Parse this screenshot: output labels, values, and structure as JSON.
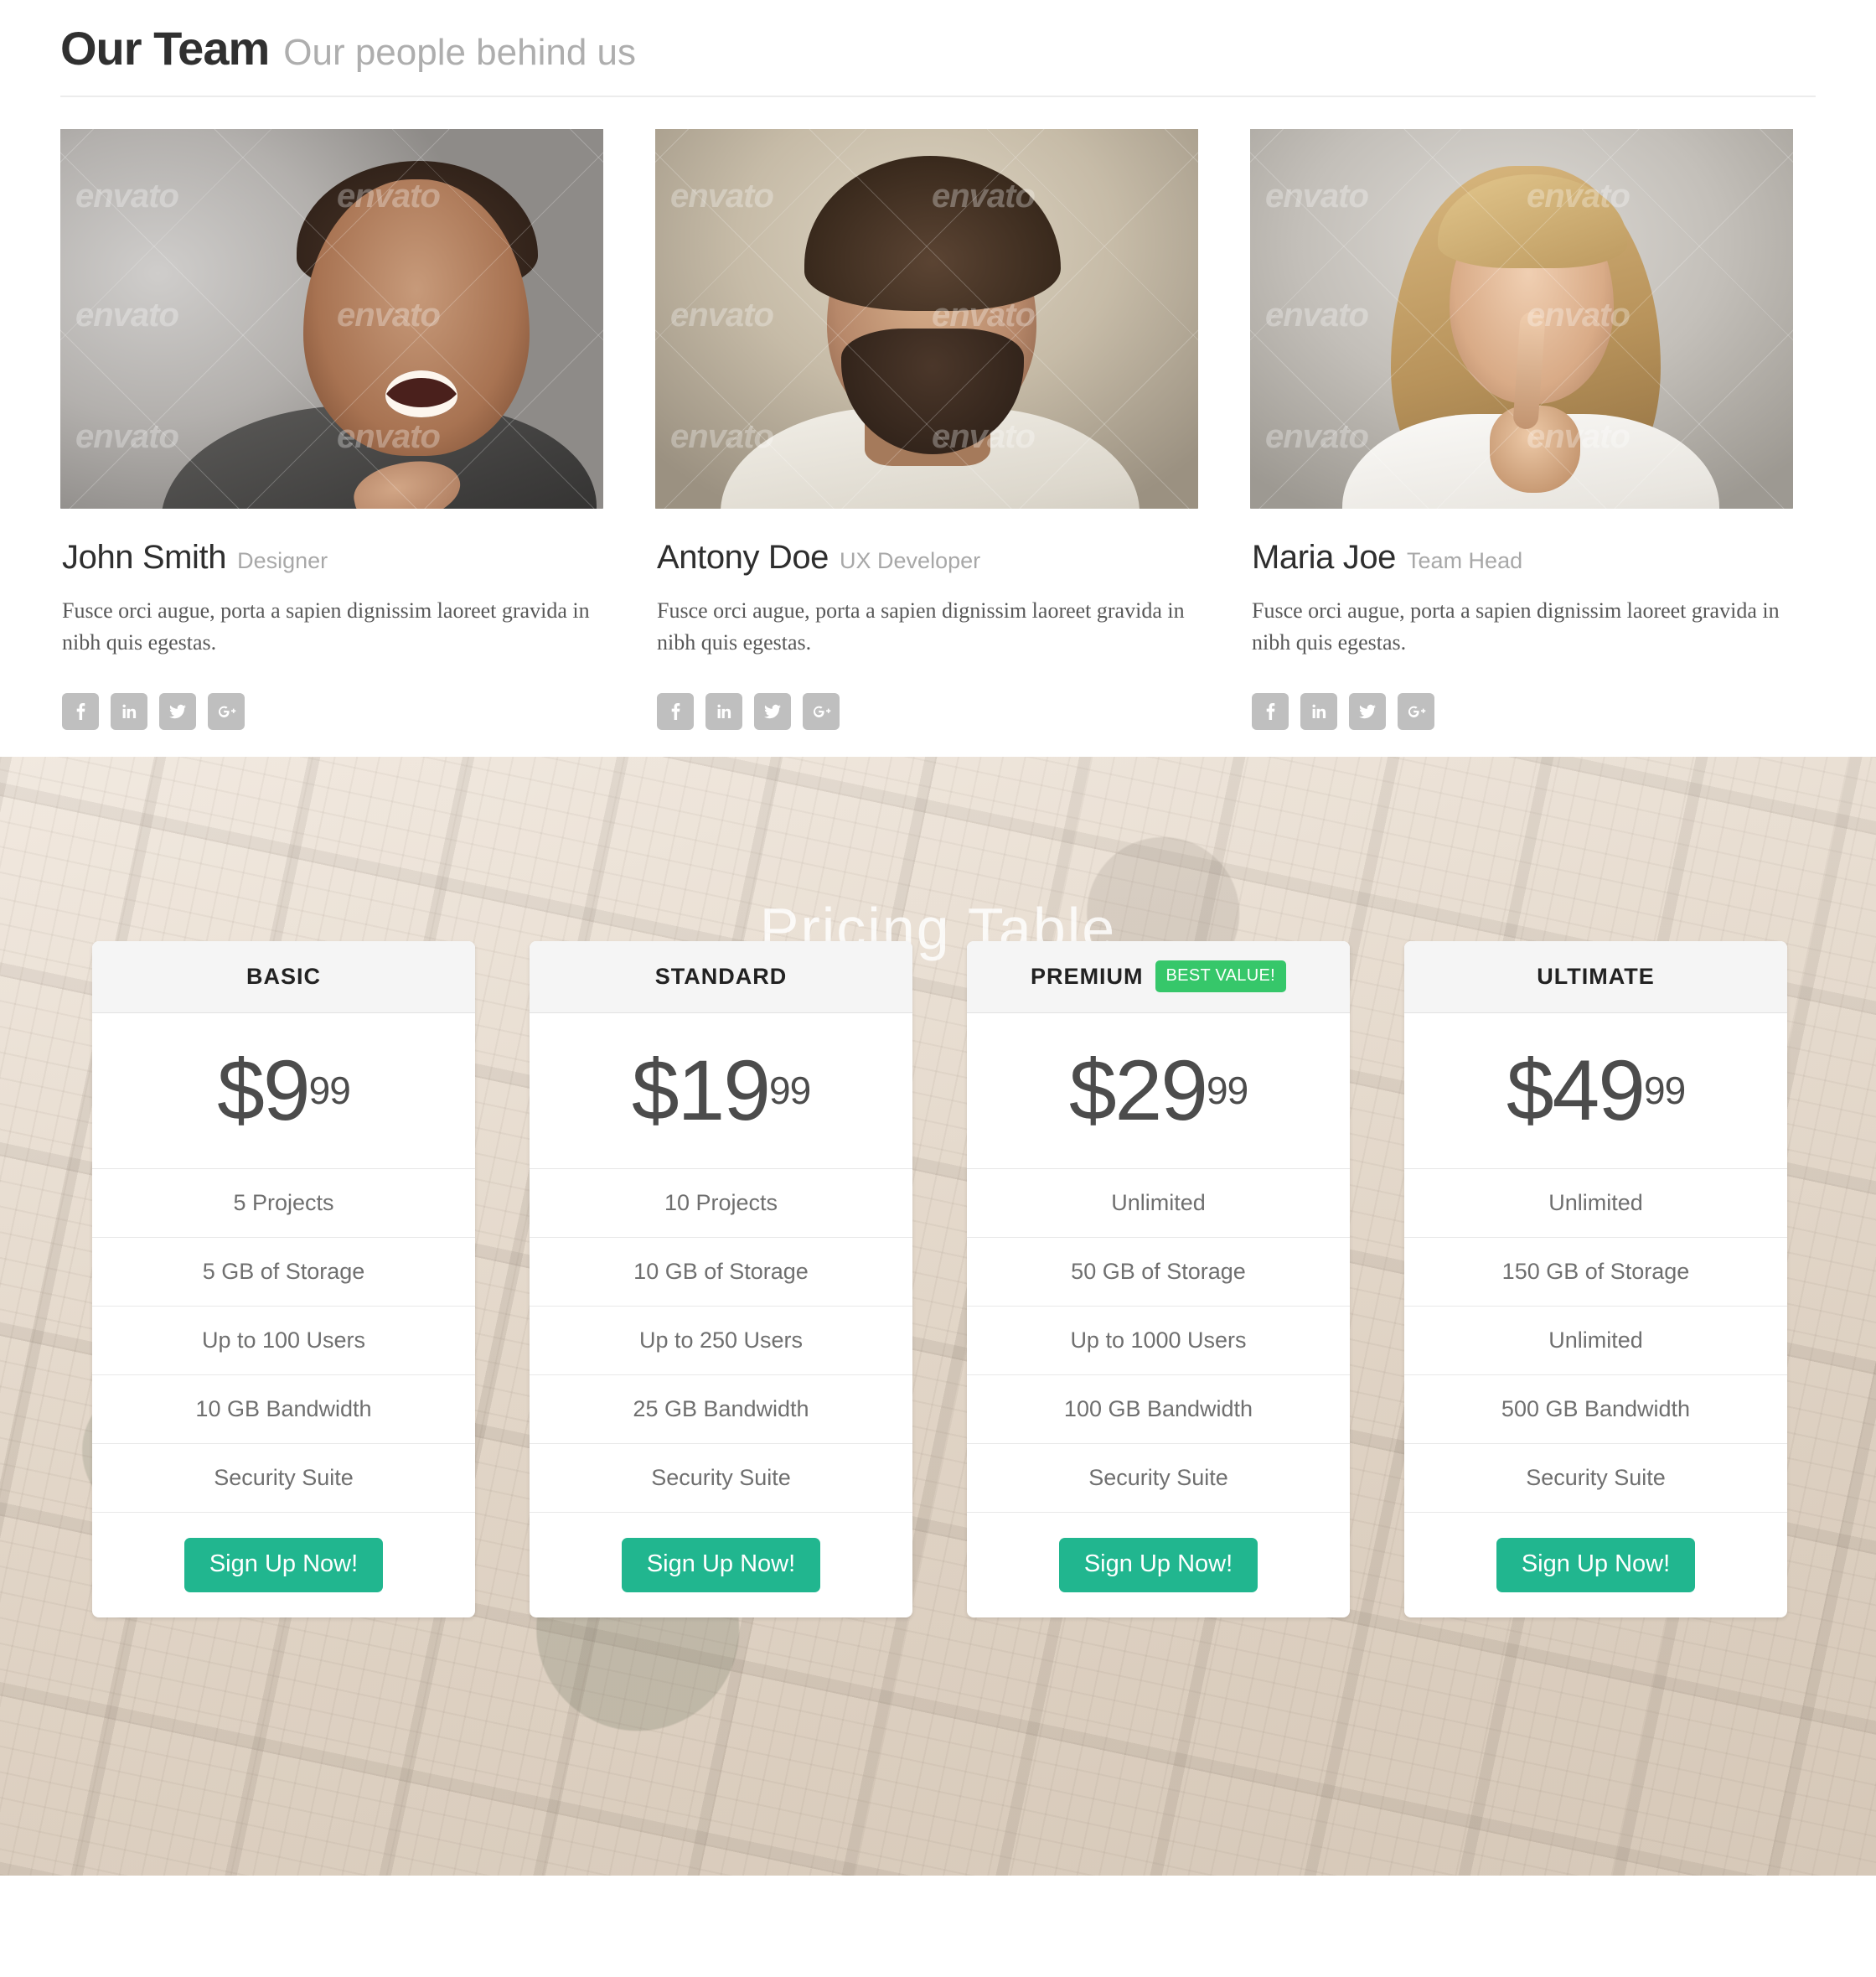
{
  "team": {
    "title": "Our Team",
    "subtitle": "Our people behind us",
    "members": [
      {
        "name": "John Smith",
        "role": "Designer",
        "bio": "Fusce orci augue, porta a sapien dignissim laoreet gravida in nibh quis egestas.",
        "photo_watermark": "envato"
      },
      {
        "name": "Antony Doe",
        "role": "UX Developer",
        "bio": "Fusce orci augue, porta a sapien dignissim laoreet gravida in nibh quis egestas.",
        "photo_watermark": "envato"
      },
      {
        "name": "Maria Joe",
        "role": "Team Head",
        "bio": "Fusce orci augue, porta a sapien dignissim laoreet gravida in nibh quis egestas.",
        "photo_watermark": "envato"
      }
    ],
    "social_icons": [
      "facebook-icon",
      "linkedin-icon",
      "twitter-icon",
      "google-plus-icon"
    ]
  },
  "pricing": {
    "title": "Pricing Table",
    "cta_label": "Sign Up Now!",
    "badge_label": "BEST VALUE!",
    "colors": {
      "badge_green": "#36c76a",
      "cta_teal": "#21b68f",
      "card_header_bg": "#f5f5f5"
    },
    "plans": [
      {
        "name": "BASIC",
        "badge": "",
        "price_main": "$9",
        "price_cents": "99",
        "features": [
          "5 Projects",
          "5 GB of Storage",
          "Up to 100 Users",
          "10 GB Bandwidth",
          "Security Suite"
        ],
        "cta": "Sign Up Now!"
      },
      {
        "name": "STANDARD",
        "badge": "",
        "price_main": "$19",
        "price_cents": "99",
        "features": [
          "10 Projects",
          "10 GB of Storage",
          "Up to 250 Users",
          "25 GB Bandwidth",
          "Security Suite"
        ],
        "cta": "Sign Up Now!"
      },
      {
        "name": "PREMIUM",
        "badge": "BEST VALUE!",
        "price_main": "$29",
        "price_cents": "99",
        "features": [
          "Unlimited",
          "50 GB of Storage",
          "Up to 1000 Users",
          "100 GB Bandwidth",
          "Security Suite"
        ],
        "cta": "Sign Up Now!"
      },
      {
        "name": "ULTIMATE",
        "badge": "",
        "price_main": "$49",
        "price_cents": "99",
        "features": [
          "Unlimited",
          "150 GB of Storage",
          "Unlimited",
          "500 GB Bandwidth",
          "Security Suite"
        ],
        "cta": "Sign Up Now!"
      }
    ]
  }
}
